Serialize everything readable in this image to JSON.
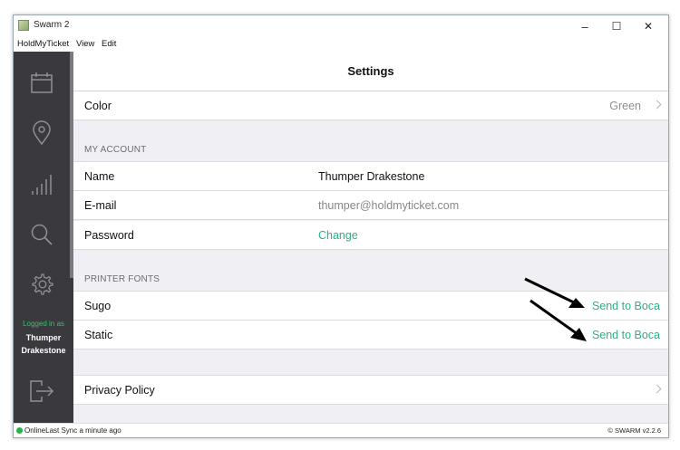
{
  "window": {
    "title": "Swarm 2",
    "minimize": "–",
    "maximize": "☐",
    "close": "✕"
  },
  "menu": [
    "HoldMyTicket",
    "View",
    "Edit"
  ],
  "sidebar": {
    "items": [
      {
        "name": "calendar-icon"
      },
      {
        "name": "location-pin-icon"
      },
      {
        "name": "signal-bars-icon"
      },
      {
        "name": "search-icon"
      },
      {
        "name": "gear-icon"
      }
    ],
    "logged_in_label": "Logged in as",
    "user_first": "Thumper",
    "user_last": "Drakestone",
    "logout_icon": "logout-icon"
  },
  "header": {
    "title": "Settings"
  },
  "settings": {
    "color": {
      "label": "Color",
      "value": "Green"
    },
    "account": {
      "heading": "MY ACCOUNT",
      "name_label": "Name",
      "name_value": "Thumper Drakestone",
      "email_label": "E-mail",
      "email_value": "thumper@holdmyticket.com",
      "password_label": "Password",
      "password_action": "Change"
    },
    "printer": {
      "heading": "PRINTER FONTS",
      "fonts": [
        {
          "label": "Sugo",
          "action": "Send to Boca"
        },
        {
          "label": "Static",
          "action": "Send to Boca"
        }
      ]
    },
    "privacy": {
      "label": "Privacy Policy"
    }
  },
  "status": {
    "text": "OnlineLast Sync a minute ago",
    "version": "© SWARM v2.2.6"
  },
  "colors": {
    "accent": "#2bb089",
    "sidebar": "#3a3a3e",
    "sidebar_green": "#33c26b",
    "muted": "#888888"
  }
}
